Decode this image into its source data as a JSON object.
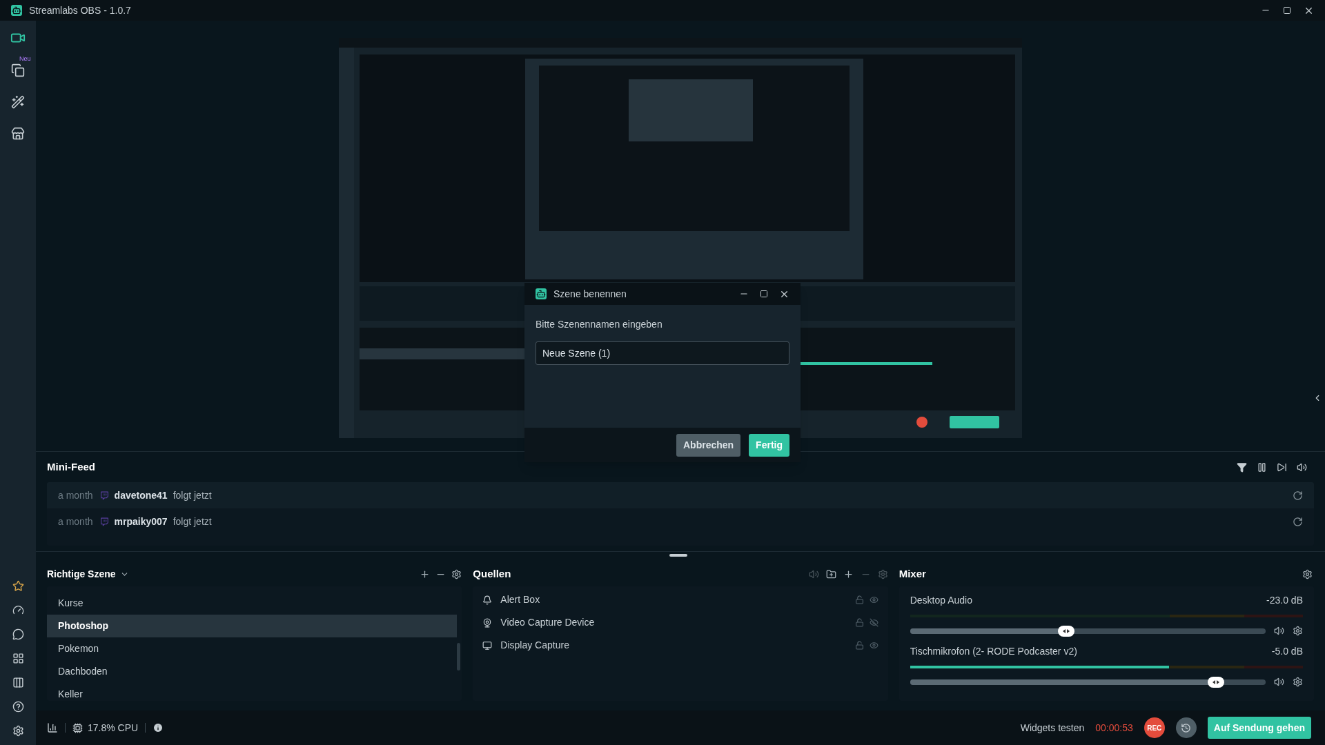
{
  "window": {
    "title": "Streamlabs OBS - 1.0.7"
  },
  "sidebar": {
    "top_items": [
      {
        "kind": "editor",
        "selected": true
      },
      {
        "kind": "themes",
        "selected": false,
        "badge": "Neu"
      },
      {
        "kind": "tools",
        "selected": false
      },
      {
        "kind": "store",
        "selected": false
      }
    ],
    "bottom_items": [
      {
        "kind": "prime"
      },
      {
        "kind": "dashboard"
      },
      {
        "kind": "chat"
      },
      {
        "kind": "layout"
      },
      {
        "kind": "studio"
      },
      {
        "kind": "help"
      },
      {
        "kind": "settings"
      }
    ]
  },
  "dialog": {
    "title": "Szene benennen",
    "prompt": "Bitte Szenennamen eingeben",
    "field_value": "Neue Szene (1)",
    "buttons": [
      {
        "label": "Abbrechen",
        "kind": "secondary"
      },
      {
        "label": "Fertig",
        "kind": "primary"
      }
    ]
  },
  "mini_feed": {
    "title": "Mini-Feed",
    "events": [
      {
        "time": "a month",
        "user": "davetone41",
        "action": "folgt jetzt"
      },
      {
        "time": "a month",
        "user": "mrpaiky007",
        "action": "folgt jetzt"
      }
    ]
  },
  "scenes": {
    "title": "Richtige Szene",
    "items": [
      {
        "label": "Kurse",
        "selected": false
      },
      {
        "label": "Photoshop",
        "selected": true
      },
      {
        "label": "Pokemon",
        "selected": false
      },
      {
        "label": "Dachboden",
        "selected": false
      },
      {
        "label": "Keller",
        "selected": false
      }
    ]
  },
  "sources": {
    "title": "Quellen",
    "items": [
      {
        "label": "Alert Box",
        "kind": "alert",
        "visible": true
      },
      {
        "label": "Video Capture Device",
        "kind": "camera",
        "visible": false
      },
      {
        "label": "Display Capture",
        "kind": "display",
        "visible": true
      }
    ]
  },
  "mixer": {
    "title": "Mixer",
    "channels": [
      {
        "name": "Desktop Audio",
        "reading": "-23.0 dB",
        "volume": {
          "level": 0.44
        }
      },
      {
        "name": "Tischmikrofon (2- RODE Podcaster v2)",
        "reading": "-5.0 dB",
        "meter": {
          "level": 0.66
        },
        "volume": {
          "level": 0.86
        }
      }
    ]
  },
  "status_bar": {
    "cpu": "17.8% CPU",
    "widgets_label": "Widgets testen",
    "timer": "00:00:53",
    "rec_label": "REC",
    "go_live": "Auf Sendung gehen"
  }
}
